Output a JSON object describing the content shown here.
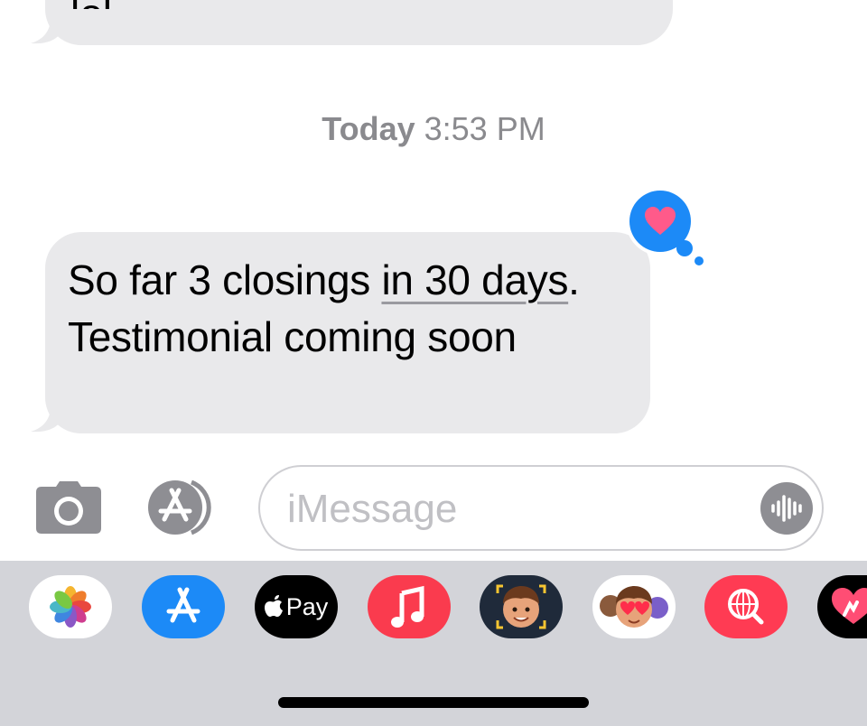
{
  "conversation": {
    "previous_message": {
      "text": "lol",
      "sender": "received"
    },
    "timestamp": {
      "day": "Today",
      "time": "3:53 PM"
    },
    "message": {
      "sender": "received",
      "text_part1": "So far 3 closings ",
      "text_link": "in 30 days",
      "text_part2": ". Testimonial coming soon",
      "reaction": {
        "type": "heart",
        "color": "#1c8af7",
        "icon": "heart-icon"
      }
    }
  },
  "input_bar": {
    "camera_icon": "camera-icon",
    "apps_icon": "app-store-icon",
    "placeholder": "iMessage",
    "audio_icon": "audio-waveform-icon"
  },
  "app_drawer": {
    "apps": [
      {
        "name": "Photos",
        "icon": "photos-icon"
      },
      {
        "name": "App Store",
        "icon": "app-store-icon"
      },
      {
        "name": "Apple Pay",
        "icon": "apple-pay-icon",
        "label": "Pay"
      },
      {
        "name": "Music",
        "icon": "music-icon"
      },
      {
        "name": "Memoji",
        "icon": "memoji-icon"
      },
      {
        "name": "Memoji Stickers",
        "icon": "memoji-stickers-icon"
      },
      {
        "name": "Images",
        "icon": "image-search-icon"
      },
      {
        "name": "Digital Touch",
        "icon": "digital-touch-icon"
      }
    ]
  },
  "colors": {
    "bubble_received": "#e9e9eb",
    "timestamp": "#8a8a8e",
    "drawer_background": "#d3d4d9",
    "accent_blue": "#1c8af7"
  }
}
